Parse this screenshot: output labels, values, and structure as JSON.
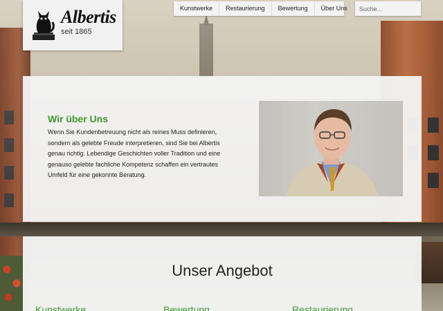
{
  "brand": {
    "name": "Albertis",
    "since": "seit 1865"
  },
  "nav": {
    "items": [
      {
        "label": "Kunstwerke"
      },
      {
        "label": "Restaurierung"
      },
      {
        "label": "Bewertung"
      },
      {
        "label": "Über Uns"
      }
    ]
  },
  "search": {
    "placeholder": "Suche..."
  },
  "about": {
    "title": "Wir über Uns",
    "text": "Wenn Sie Kundenbetreuung nicht als reines Muss definieren, sondern als gelebte Freude interpretieren, sind Sie bei Albertis genau richtig. Lebendige Geschichten voller Tradition und eine genauso gelebte fachliche Kompetenz schaffen ein vertrautes Umfeld für eine gekonnte Beratung."
  },
  "offer": {
    "title": "Unser Angebot",
    "columns": [
      {
        "label": "Kunstwerke"
      },
      {
        "label": "Bewertung"
      },
      {
        "label": "Restaurierung"
      }
    ]
  },
  "colors": {
    "accent_green": "#3a9a2a",
    "panel": "#f3f3f3"
  },
  "icons": {
    "logo": "black-cat-on-books-icon",
    "photo": "portrait-photo"
  }
}
